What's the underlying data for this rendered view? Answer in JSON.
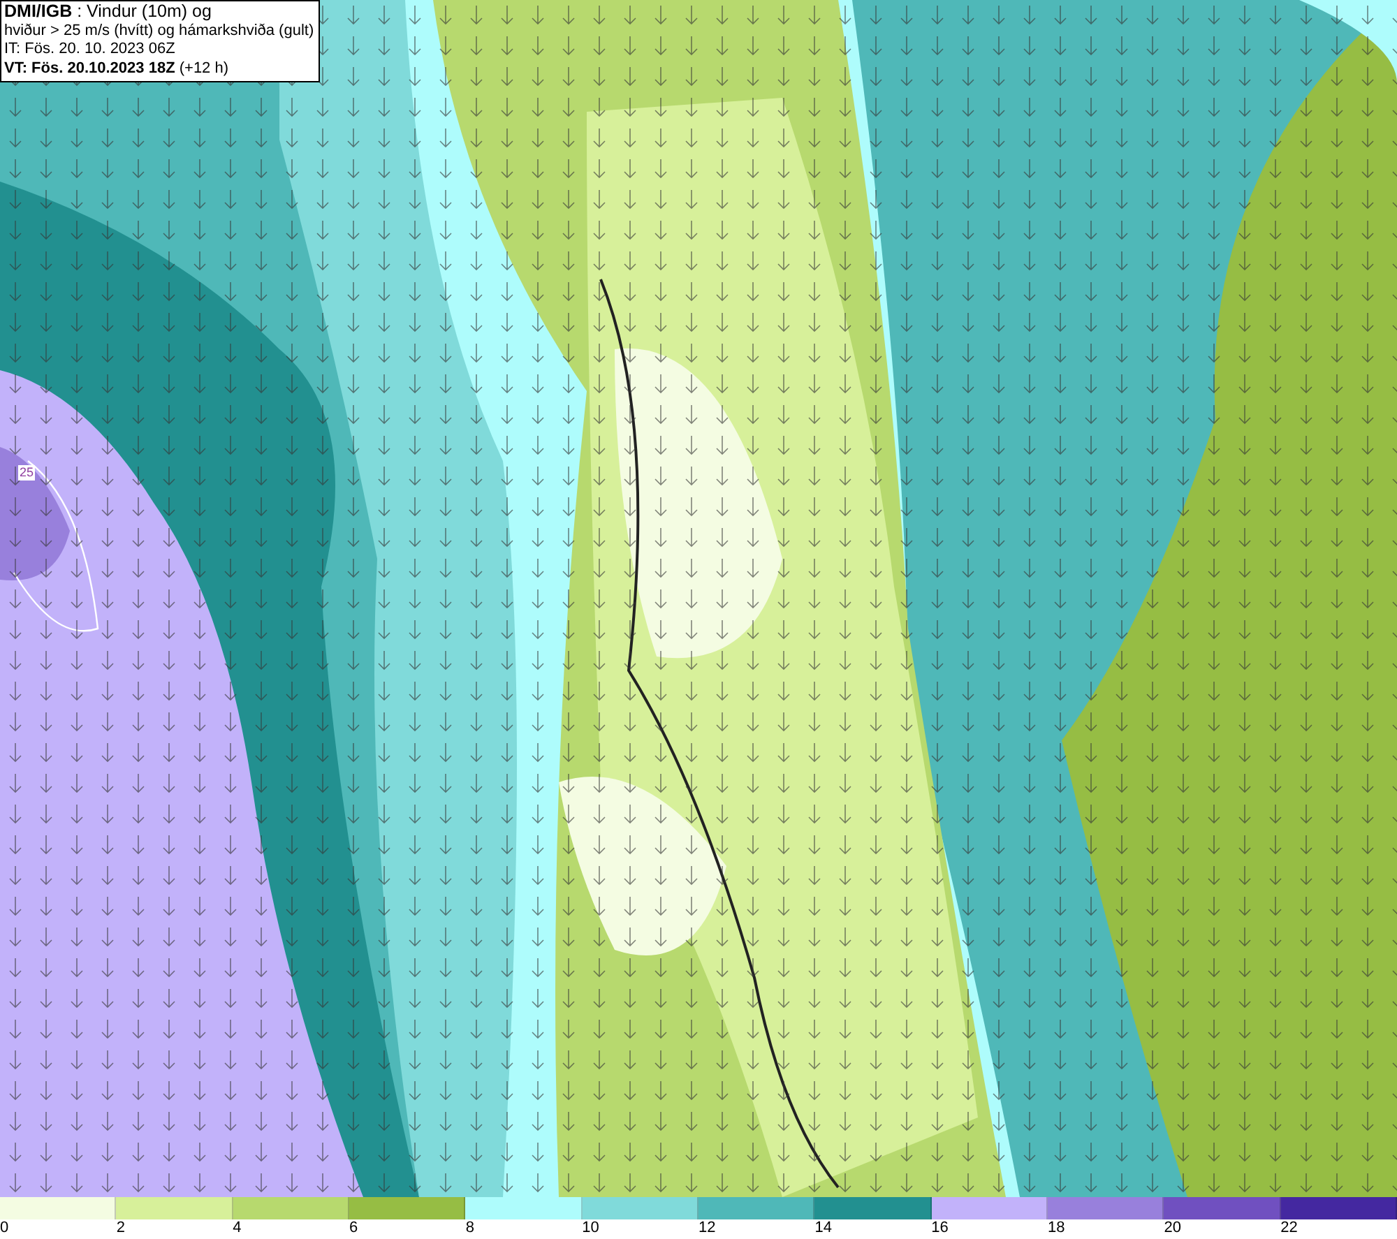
{
  "header": {
    "lines": [
      "**DMI/IGB** : Vindur (10m) og",
      "hviður > 25 m/s (hvítt) og hámarkshviða (gult)",
      "IT: Fös. 20. 10. 2023 06Z",
      "**VT: Fös. 20.10.2023 18Z** (+12 h)"
    ]
  },
  "map": {
    "contour_label": "25"
  },
  "legend": {
    "bins": [
      {
        "color": "#f4fce2",
        "label": "0"
      },
      {
        "color": "#d7f09a",
        "label": "2"
      },
      {
        "color": "#b7d96e",
        "label": "4"
      },
      {
        "color": "#96bd44",
        "label": "6"
      },
      {
        "color": "#aefcfc",
        "label": "8"
      },
      {
        "color": "#80dada",
        "label": "10"
      },
      {
        "color": "#4fb8b8",
        "label": "12"
      },
      {
        "color": "#229090",
        "label": "14"
      },
      {
        "color": "#c2b2fa",
        "label": "16"
      },
      {
        "color": "#9880dc",
        "label": "18"
      },
      {
        "color": "#7050c0",
        "label": "20"
      },
      {
        "color": "#4428a0",
        "label": "22"
      }
    ]
  }
}
